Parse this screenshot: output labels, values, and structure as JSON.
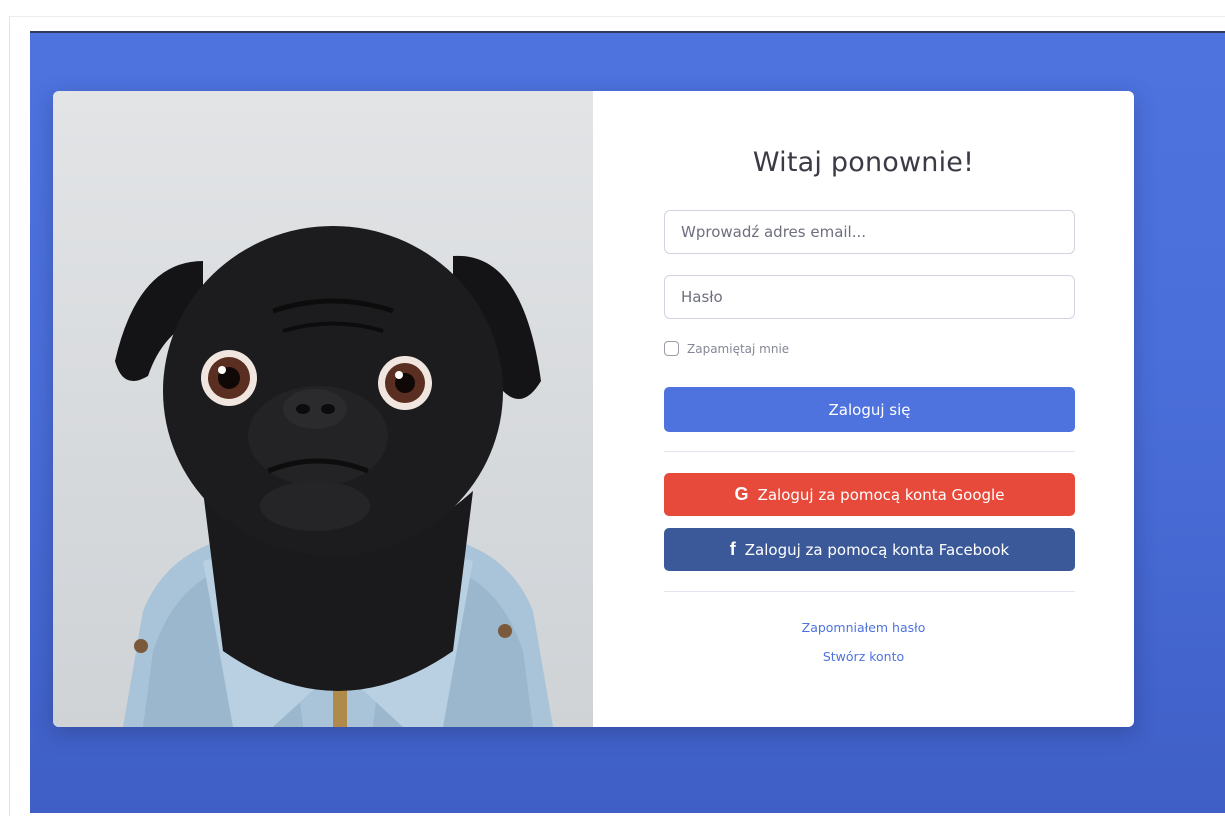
{
  "login": {
    "title": "Witaj ponownie!",
    "email_placeholder": "Wprowadź adres email...",
    "password_placeholder": "Hasło",
    "remember_label": "Zapamiętaj mnie",
    "login_button": "Zaloguj się",
    "google_button": "Zaloguj za pomocą konta Google",
    "facebook_button": "Zaloguj za pomocą konta Facebook",
    "google_glyph": "G",
    "facebook_glyph": "f",
    "forgot_link": "Zapomniałem hasło",
    "create_link": "Stwórz konto"
  },
  "icons": {
    "google": "google-icon",
    "facebook": "facebook-icon"
  },
  "colors": {
    "background": "#4e73df",
    "primary_button": "#4e73df",
    "google_button": "#e74a3b",
    "facebook_button": "#3b5998",
    "title_text": "#3a3b45",
    "muted_text": "#858796"
  }
}
